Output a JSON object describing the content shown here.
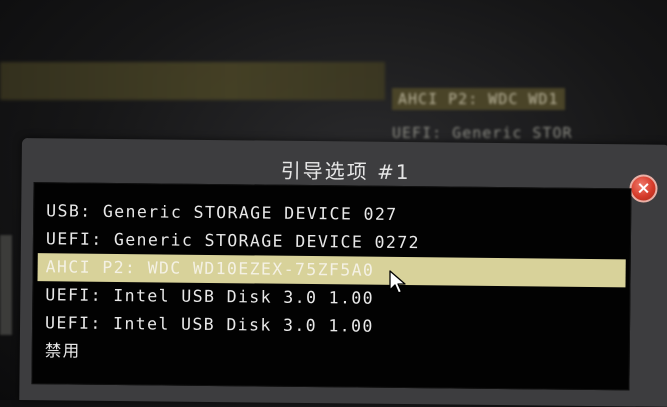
{
  "background": {
    "items": [
      "AHCI P2: WDC WD1",
      "UEFI: Generic STOR"
    ]
  },
  "dialog": {
    "title": "引导选项 #1",
    "close_label": "×",
    "options": [
      "USB: Generic STORAGE DEVICE 027",
      "UEFI: Generic STORAGE DEVICE 0272",
      "AHCI P2: WDC WD10EZEX-75ZF5A0",
      "UEFI: Intel USB Disk 3.0 1.00",
      "UEFI: Intel USB Disk 3.0 1.00",
      "禁用"
    ],
    "selected_index": 2
  },
  "colors": {
    "highlight": "#d8d29a",
    "close_button": "#d63b2a"
  },
  "icons": [
    "close-icon",
    "mouse-cursor-icon"
  ]
}
